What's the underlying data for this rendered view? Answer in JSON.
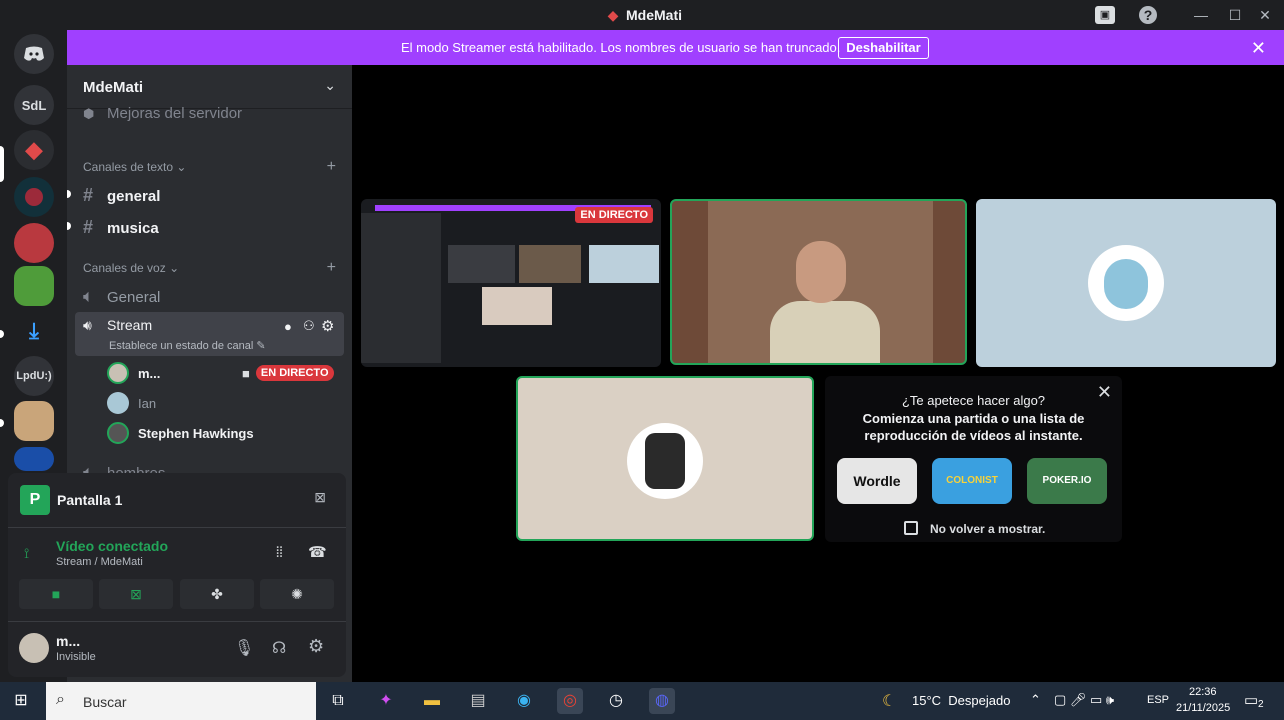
{
  "window": {
    "title": "MdeMati"
  },
  "banner": {
    "message": "El modo Streamer está habilitado. Los nombres de usuario se han truncado.",
    "button_label": "Deshabilitar"
  },
  "rail": {
    "items": [
      "SdL",
      "LpdU:)"
    ]
  },
  "server": {
    "name": "MdeMati",
    "boost_item": "Mejoras del servidor"
  },
  "text_category": {
    "label": "Canales de texto"
  },
  "text_channels": [
    "general",
    "musica"
  ],
  "voice_category": {
    "label": "Canales de voz"
  },
  "voice_channels": {
    "general": "General",
    "stream": "Stream",
    "stream_status": "Establece un estado de canal",
    "next": "hombres"
  },
  "voice_users": [
    {
      "name": "m...",
      "badge": "EN DIRECTO"
    },
    {
      "name": "Ian"
    },
    {
      "name": "Stephen Hawkings"
    }
  ],
  "screen_share": {
    "label": "Pantalla 1"
  },
  "connection": {
    "status": "Vídeo conectado",
    "channel": "Stream / MdeMati"
  },
  "user_panel": {
    "name": "m...",
    "status": "Invisible"
  },
  "live_badge": "EN DIRECTO",
  "activity": {
    "title": "¿Te apetece hacer algo?",
    "subtitle": "Comienza una partida o una lista de reproducción de vídeos al instante.",
    "games": [
      "Wordle",
      "COLONIST",
      "POKER.IO"
    ],
    "checkbox_label": "No volver a mostrar."
  },
  "taskbar": {
    "search_placeholder": "Buscar",
    "weather": "15°C  Despejado",
    "lang": "ESP",
    "time": "22:36",
    "date": "21/11/2025",
    "notif_count": "2"
  },
  "colors": {
    "accent": "#a040ff",
    "live": "#da373c",
    "speaking": "#23a559",
    "bg": "#2b2d31"
  }
}
